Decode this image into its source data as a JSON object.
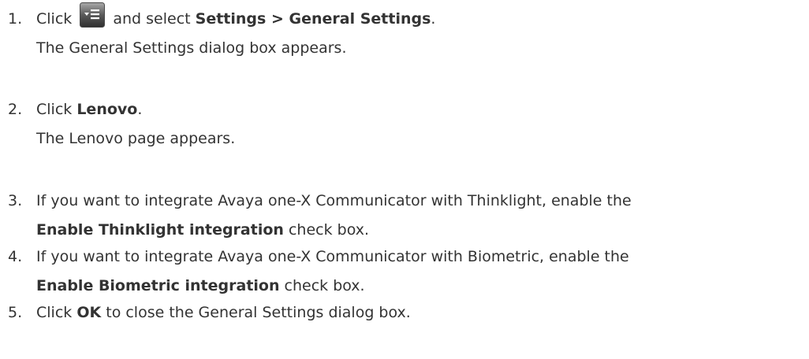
{
  "steps": [
    {
      "number": "1.",
      "lines": [
        {
          "parts": [
            {
              "t": "Click ",
              "bold": false
            },
            {
              "icon": "menu-icon"
            },
            {
              "t": " and select ",
              "bold": false
            },
            {
              "t": "Settings > General Settings",
              "bold": true
            },
            {
              "t": ".",
              "bold": false
            }
          ]
        },
        {
          "parts": [
            {
              "t": "The General Settings dialog box appears.",
              "bold": false
            }
          ]
        }
      ]
    },
    {
      "number": "2.",
      "lines": [
        {
          "parts": [
            {
              "t": "Click ",
              "bold": false
            },
            {
              "t": "Lenovo",
              "bold": true
            },
            {
              "t": ".",
              "bold": false
            }
          ]
        },
        {
          "parts": [
            {
              "t": "The Lenovo page appears.",
              "bold": false
            }
          ]
        }
      ]
    },
    {
      "number": "3.",
      "lines": [
        {
          "parts": [
            {
              "t": "If you want to integrate Avaya one-X Communicator with Thinklight, enable the",
              "bold": false
            }
          ]
        },
        {
          "parts": [
            {
              "t": "Enable Thinklight integration",
              "bold": true
            },
            {
              "t": " check box.",
              "bold": false
            }
          ]
        }
      ]
    },
    {
      "number": "4.",
      "lines": [
        {
          "parts": [
            {
              "t": "If you want to integrate Avaya one-X Communicator with Biometric, enable the",
              "bold": false
            }
          ]
        },
        {
          "parts": [
            {
              "t": "Enable Biometric integration",
              "bold": true
            },
            {
              "t": " check box.",
              "bold": false
            }
          ]
        }
      ]
    },
    {
      "number": "5.",
      "lines": [
        {
          "parts": [
            {
              "t": "Click ",
              "bold": false
            },
            {
              "t": "OK",
              "bold": true
            },
            {
              "t": " to close the General Settings dialog box.",
              "bold": false
            }
          ]
        }
      ]
    }
  ],
  "colors": {
    "text": "#333333",
    "icon_dark": "#3a3a3a",
    "icon_light": "#9a9a9a"
  }
}
